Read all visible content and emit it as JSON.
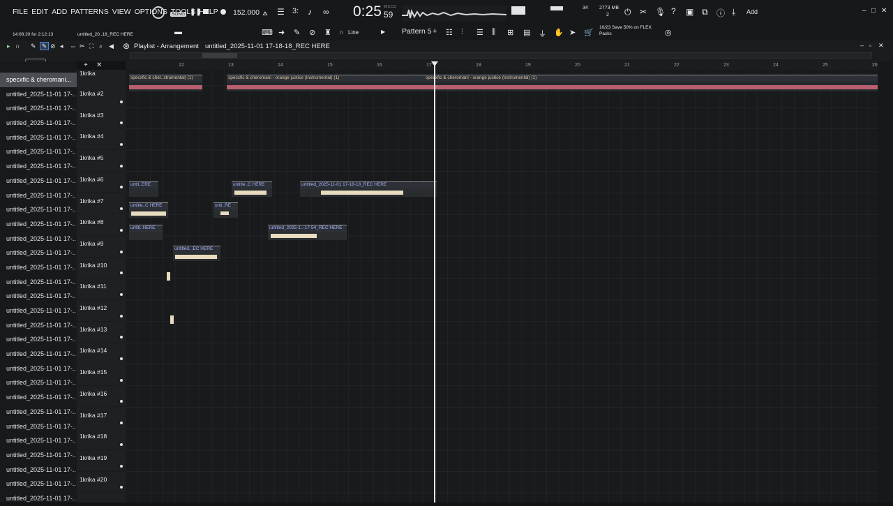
{
  "menu": [
    "FILE",
    "EDIT",
    "ADD",
    "PATTERNS",
    "VIEW",
    "OPTIONS",
    "TOOLS",
    "HELP"
  ],
  "transport": {
    "song_label": "SONG",
    "tempo": "152.000",
    "time": "0:25",
    "time_small": "59",
    "time_label": "M:S:CS",
    "memory": "2773 MB",
    "cpu": "34",
    "voices": "2",
    "add": "Add"
  },
  "hint": {
    "line1": "14:08:20 for 2:12:13",
    "line2": "untitled_20..18_REC HERE"
  },
  "toolbar": {
    "snap": "Line",
    "pattern": "Pattern 5",
    "news": "10/23  Save 50% on FLEX",
    "news2": "Packs"
  },
  "playlist": {
    "title": "Playlist - Arrangement",
    "subtitle": "untitled_2025-11-01 17-18-18_REC HERE"
  },
  "browser": {
    "selected": "specxfic & cheromani...",
    "items": [
      "untitled_2025-11-01 17-..",
      "untitled_2025-11-01 17-..",
      "untitled_2025-11-01 17-..",
      "untitled_2025-11-01 17-..",
      "untitled_2025-11-01 17-..",
      "untitled_2025-11-01 17-..",
      "untitled_2025-11-01 17-..",
      "untitled_2025-11-01 17-..",
      "untitled_2025-11-01 17-..",
      "untitled_2025-11-01 17-..",
      "untitled_2025-11-01 17-..",
      "untitled_2025-11-01 17-..",
      "untitled_2025-11-01 17-..",
      "untitled_2025-11-01 17-..",
      "untitled_2025-11-01 17-..",
      "untitled_2025-11-01 17-..",
      "untitled_2025-11-01 17-..",
      "untitled_2025-11-01 17-..",
      "untitled_2025-11-01 17-..",
      "untitled_2025-11-01 17-..",
      "untitled_2025-11-01 17-..",
      "untitled_2025-11-01 17-..",
      "untitled_2025-11-01 17-..",
      "untitled_2025-11-01 17-..",
      "untitled_2025-11-01 17-..",
      "untitled_2025-11-01 17-..",
      "untitled_2025-11-01 17-..",
      "untitled_2025-11-01 17-..",
      "untitled_2025-11-01 17-.."
    ]
  },
  "tracks": [
    "1krika #2",
    "1krika #3",
    "1krika #4",
    "1krika #5",
    "1krika #6",
    "1krika #7",
    "1krika #8",
    "1krika #9",
    "1krika #10",
    "1krika #11",
    "1krika #12",
    "1krika #13",
    "1krika #14",
    "1krika #15",
    "1krika #16",
    "1krika #17",
    "1krika #18",
    "1krika #19",
    "1krika #20"
  ],
  "track1": "1krika",
  "ruler": [
    "12",
    "13",
    "14",
    "15",
    "16",
    "17",
    "18",
    "19",
    "20",
    "21",
    "22",
    "23",
    "24",
    "25",
    "26"
  ],
  "clips": {
    "a1": "specxfic & cher..strumental) (1)",
    "a2": "specxfic & cheromani - orange justice (instrumental) (1)",
    "a3": "specxfic & cheromani - orange justice (instrumental) (1)",
    "c1": "untit..ERE",
    "c2": "untitle..C HERE",
    "c3": "untitled_2025-11-01 17-18-18_REC HERE",
    "c4": "untitle..C HERE",
    "c5": "unti..RE",
    "c6": "untitl..HERE",
    "c7": "untitled_2025-1..-17-54_REC HERE",
    "c8": "untitled...EC HERE"
  }
}
